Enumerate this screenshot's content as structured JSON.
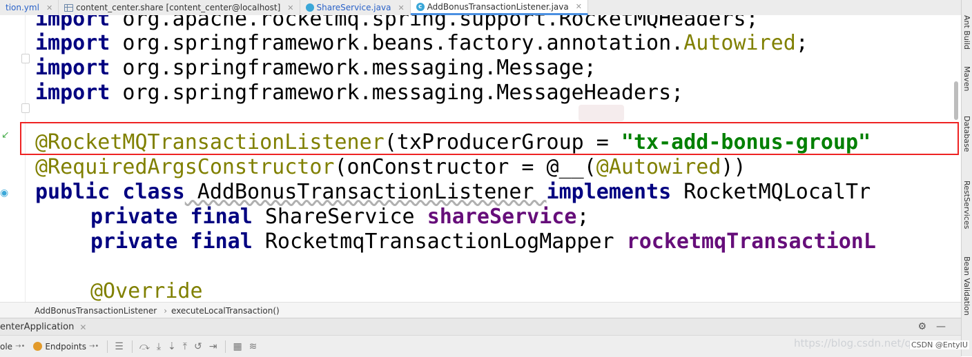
{
  "tabs": [
    {
      "label": "tion.yml",
      "active": false
    },
    {
      "label": "content_center.share [content_center@localhost]",
      "active": false
    },
    {
      "label": "ShareService.java",
      "active": false
    },
    {
      "label": "AddBonusTransactionListener.java",
      "active": true
    }
  ],
  "code": {
    "l0": {
      "kw": "import",
      "rest": " org.apache.rocketmq.spring.support.RocketMQHeaders;"
    },
    "l1": {
      "kw": "import",
      "rest": " org.springframework.beans.factory.annotation.",
      "ann": "Autowired",
      "end": ";"
    },
    "l2": {
      "kw": "import",
      "rest": " org.springframework.messaging.Message;"
    },
    "l3": {
      "kw": "import",
      "rest": " org.springframework.messaging.MessageHeaders;"
    },
    "l5": {
      "ann": "@RocketMQTransactionListener",
      "rest": "(txProducerGroup = ",
      "str": "\"tx-add-bonus-group\""
    },
    "l6": {
      "ann": "@RequiredArgsConstructor",
      "rest1": "(onConstructor = ",
      "at": "@__",
      "rest2": "(",
      "ann2": "@Autowired",
      "rest3": "))"
    },
    "l7": {
      "kw1": "public class",
      "name": " AddBonusTransactionListener ",
      "kw2": "implements",
      "rest": " RocketMQLocalTr"
    },
    "l8": {
      "kw": "private final",
      "type": " ShareService ",
      "field": "shareService",
      "end": ";"
    },
    "l9": {
      "kw": "private final",
      "type": " RocketmqTransactionLogMapper ",
      "field": "rocketmqTransactionL"
    },
    "l11": {
      "ann": "@Override"
    }
  },
  "breadcrumb": {
    "class_name": "AddBonusTransactionListener",
    "method": "executeLocalTransaction()",
    "sep": "›"
  },
  "run_panel": {
    "tab_label": "enterApplication",
    "toolbar_console": "ole",
    "toolbar_endpoints": "Endpoints"
  },
  "right_sidebar": [
    "Ant Build",
    "Maven",
    "Database",
    "RestServices",
    "Bean Validation"
  ],
  "watermark": "https://blog.csdn.net/qq",
  "csdn_badge": "CSDN @EntyIU",
  "colors": {
    "highlight_box": "#e22222",
    "keyword": "#000080",
    "annotation": "#808000",
    "string": "#008000",
    "field": "#660e7a"
  }
}
